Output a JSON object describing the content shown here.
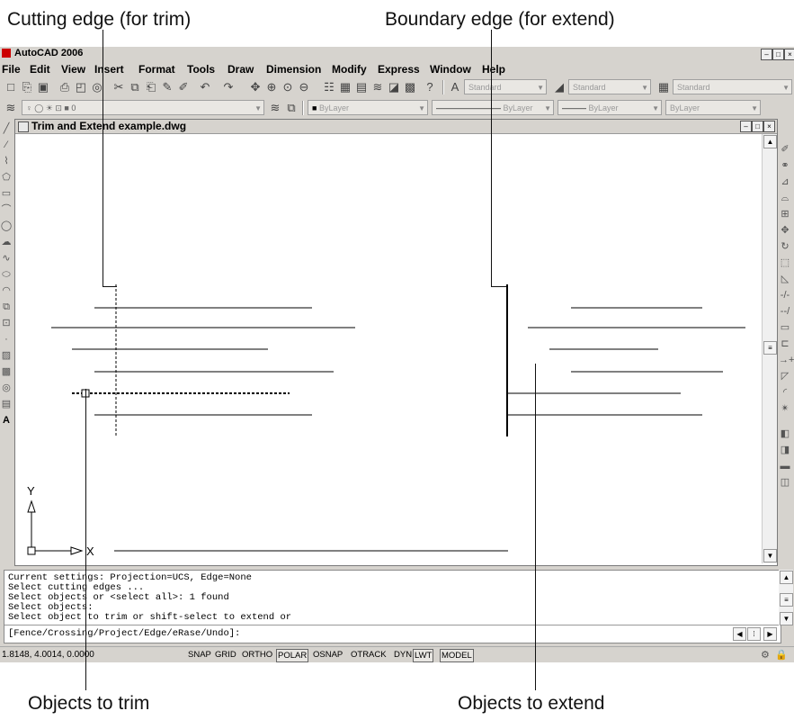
{
  "callouts": {
    "cutting_edge": "Cutting edge (for trim)",
    "boundary_edge": "Boundary edge (for extend)",
    "objects_to_trim": "Objects to trim",
    "objects_to_extend": "Objects to extend"
  },
  "app": {
    "title": "AutoCAD 2006",
    "menu": [
      "File",
      "Edit",
      "View",
      "Insert",
      "Format",
      "Tools",
      "Draw",
      "Dimension",
      "Modify",
      "Express",
      "Window",
      "Help"
    ]
  },
  "toolbar": {
    "text_style": "Standard",
    "dim_style": "Standard",
    "table_style": "Standard",
    "layer": "0",
    "color": "ByLayer",
    "linetype": "ByLayer",
    "lineweight": "ByLayer",
    "plotstyle": "ByLayer"
  },
  "drawing": {
    "title": "Trim and Extend example.dwg",
    "ucs_y": "Y",
    "ucs_x": "X"
  },
  "command": {
    "lines": [
      "Current settings: Projection=UCS, Edge=None",
      "Select cutting edges ...",
      "Select objects or <select all>: 1 found",
      "Select objects:",
      "Select object to trim or shift-select to extend or"
    ],
    "prompt": "[Fence/Crossing/Project/Edge/eRase/Undo]:"
  },
  "status": {
    "coords": "1.8148, 4.0014, 0.0000",
    "buttons": [
      "SNAP",
      "GRID",
      "ORTHO",
      "POLAR",
      "OSNAP",
      "OTRACK",
      "DYN",
      "LWT",
      "MODEL"
    ]
  },
  "colors": {
    "window_bg": "#d6d3ce",
    "canvas_bg": "#ffffff"
  }
}
